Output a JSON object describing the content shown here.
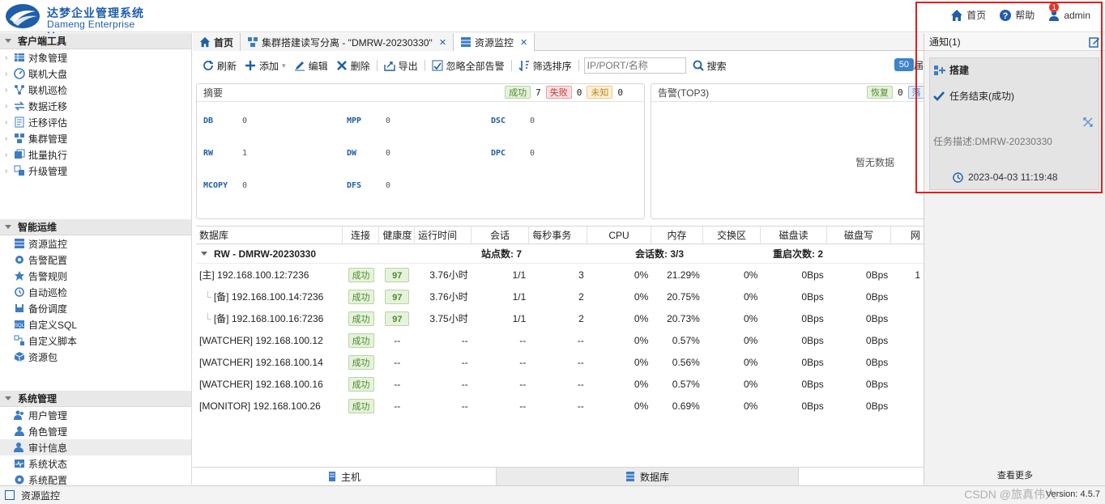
{
  "app": {
    "title_cn": "达梦企业管理系统",
    "title_en": "Dameng Enterprise Manager"
  },
  "topnav": {
    "home": "首页",
    "help": "帮助",
    "user": "admin",
    "user_badge": "1"
  },
  "sidebar": {
    "groups": [
      {
        "title": "客户端工具",
        "items": [
          "对象管理",
          "联机大盘",
          "联机巡检",
          "数据迁移",
          "迁移评估",
          "集群管理",
          "批量执行",
          "升级管理"
        ]
      },
      {
        "title": "智能运维",
        "items": [
          "资源监控",
          "告警配置",
          "告警规则",
          "自动巡检",
          "备份调度",
          "自定义SQL",
          "自定义脚本",
          "资源包"
        ]
      },
      {
        "title": "系统管理",
        "items": [
          "用户管理",
          "角色管理",
          "审计信息",
          "系统状态",
          "系统配置"
        ]
      }
    ]
  },
  "tabs": {
    "home": "首页",
    "cluster": "集群搭建读写分离 - \"DMRW-20230330\"",
    "monitor": "资源监控"
  },
  "toolbar": {
    "refresh": "刷新",
    "add": "添加",
    "edit": "编辑",
    "delete": "删除",
    "export": "导出",
    "ignore_alerts": "忽略全部告警",
    "filter_sort": "筛选排序",
    "search_placeholder": "IP/PORT/名称",
    "search": "搜索",
    "page_size": "50",
    "page_size_suffix": "届"
  },
  "summary": {
    "title": "摘要",
    "success_label": "成功",
    "success_count": "7",
    "fail_label": "失败",
    "fail_count": "0",
    "unknown_label": "未知",
    "unknown_count": "0",
    "cells": [
      {
        "k": "DB",
        "v": "0"
      },
      {
        "k": "MPP",
        "v": "0"
      },
      {
        "k": "DSC",
        "v": "0"
      },
      {
        "k": "RW",
        "v": "1"
      },
      {
        "k": "DW",
        "v": "0"
      },
      {
        "k": "DPC",
        "v": "0"
      },
      {
        "k": "MCOPY",
        "v": "0"
      },
      {
        "k": "DFS",
        "v": "0"
      }
    ]
  },
  "alarm": {
    "title": "告警(TOP3)",
    "recover_label": "恢复",
    "recover_count": "0",
    "extra_label": "落",
    "empty": "暂无数据"
  },
  "grid": {
    "headers": [
      "数据库",
      "连接",
      "健康度",
      "运行时间",
      "会话",
      "每秒事务",
      "CPU",
      "内存",
      "交换区",
      "磁盘读",
      "磁盘写",
      "网"
    ],
    "group": {
      "name": "RW - DMRW-20230330",
      "sites": "站点数: 7",
      "sessions": "会话数: 3/3",
      "restarts": "重启次数: 2"
    },
    "rows": [
      {
        "name": "[主] 192.168.100.12:7236",
        "indent": false,
        "conn": "成功",
        "health": "97",
        "uptime": "3.76小时",
        "session": "1/1",
        "tps": "3",
        "cpu": "0%",
        "mem": "21.29%",
        "swap": "0%",
        "dread": "0Bps",
        "dwrite": "0Bps",
        "net": "1"
      },
      {
        "name": "[备] 192.168.100.14:7236",
        "indent": true,
        "conn": "成功",
        "health": "97",
        "uptime": "3.76小时",
        "session": "1/1",
        "tps": "2",
        "cpu": "0%",
        "mem": "20.75%",
        "swap": "0%",
        "dread": "0Bps",
        "dwrite": "0Bps",
        "net": ""
      },
      {
        "name": "[备] 192.168.100.16:7236",
        "indent": true,
        "conn": "成功",
        "health": "97",
        "uptime": "3.75小时",
        "session": "1/1",
        "tps": "2",
        "cpu": "0%",
        "mem": "20.73%",
        "swap": "0%",
        "dread": "0Bps",
        "dwrite": "0Bps",
        "net": ""
      },
      {
        "name": "[WATCHER] 192.168.100.12",
        "indent": false,
        "conn": "成功",
        "health": "--",
        "uptime": "--",
        "session": "--",
        "tps": "--",
        "cpu": "0%",
        "mem": "0.57%",
        "swap": "0%",
        "dread": "0Bps",
        "dwrite": "0Bps",
        "net": ""
      },
      {
        "name": "[WATCHER] 192.168.100.14",
        "indent": false,
        "conn": "成功",
        "health": "--",
        "uptime": "--",
        "session": "--",
        "tps": "--",
        "cpu": "0%",
        "mem": "0.56%",
        "swap": "0%",
        "dread": "0Bps",
        "dwrite": "0Bps",
        "net": ""
      },
      {
        "name": "[WATCHER] 192.168.100.16",
        "indent": false,
        "conn": "成功",
        "health": "--",
        "uptime": "--",
        "session": "--",
        "tps": "--",
        "cpu": "0%",
        "mem": "0.57%",
        "swap": "0%",
        "dread": "0Bps",
        "dwrite": "0Bps",
        "net": ""
      },
      {
        "name": "[MONITOR] 192.168.100.26",
        "indent": false,
        "conn": "成功",
        "health": "--",
        "uptime": "--",
        "session": "--",
        "tps": "--",
        "cpu": "0%",
        "mem": "0.69%",
        "swap": "0%",
        "dread": "0Bps",
        "dwrite": "0Bps",
        "net": ""
      }
    ]
  },
  "bottom_tabs": {
    "host": "主机",
    "database": "数据库"
  },
  "notify": {
    "title": "通知(1)",
    "card_title": "搭建",
    "status": "任务结束(成功)",
    "desc": "任务描述:DMRW-20230330",
    "time": "2023-04-03 11:19:48",
    "more": "查看更多"
  },
  "statusbar": {
    "label": "资源监控",
    "version": "Version: 4.5.7",
    "watermark": "CSDN @旅真伟大"
  },
  "colors": {
    "brand": "#1f5ea8",
    "success": "#4d8b2a",
    "fail": "#c23a3a",
    "unknown": "#c5841c",
    "highlight_frame": "#e02020"
  }
}
